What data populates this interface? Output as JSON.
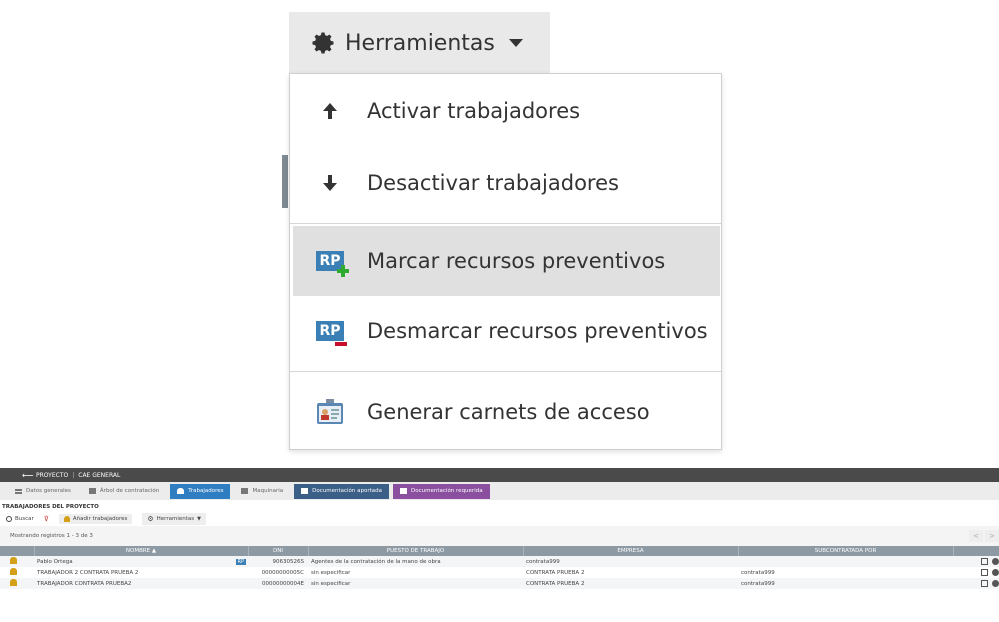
{
  "dropdown": {
    "button_label": "Herramientas",
    "items": [
      {
        "label": "Activar trabajadores",
        "icon": "arrow-up-icon"
      },
      {
        "label": "Desactivar trabajadores",
        "icon": "arrow-down-icon"
      },
      {
        "label": "Marcar recursos preventivos",
        "icon": "rp-add-icon",
        "badge": "RP",
        "highlighted": true
      },
      {
        "label": "Desmarcar recursos preventivos",
        "icon": "rp-remove-icon",
        "badge": "RP"
      },
      {
        "label": "Generar carnets de acceso",
        "icon": "id-card-icon"
      }
    ]
  },
  "app": {
    "breadcrumb": {
      "project": "PROYECTO",
      "name": "CAE GENERAL"
    },
    "tabs": [
      {
        "label": "Datos generales"
      },
      {
        "label": "Árbol de contratación"
      },
      {
        "label": "Trabajadores",
        "active": true
      },
      {
        "label": "Maquinaria"
      },
      {
        "label": "Documentación aportada"
      },
      {
        "label": "Documentación requerida"
      }
    ],
    "section_title": "TRABAJADORES DEL PROYECTO",
    "toolbar": {
      "search": "Buscar",
      "add_workers": "Añadir trabajadores",
      "tools": "Herramientas"
    },
    "showing": "Mostrando registros 1 - 3 de 3",
    "pager": {
      "prev": "<",
      "next": ">"
    },
    "table": {
      "columns": [
        "NOMBRE ▲",
        "DNI",
        "PUESTO DE TRABAJO",
        "EMPRESA",
        "SUBCONTRATADA POR"
      ],
      "rows": [
        {
          "nombre": "Pablo Ortega",
          "rp": "RP",
          "dni": "90630526S",
          "puesto": "Agentes de la contratación de la mano de obra",
          "empresa": "contrata999",
          "sub": ""
        },
        {
          "nombre": "TRABAJADOR 2 CONTRATA PRUEBA 2",
          "rp": "",
          "dni": "00000000005C",
          "puesto": "sin especificar",
          "empresa": "CONTRATA PRUEBA 2",
          "sub": "contrata999"
        },
        {
          "nombre": "TRABAJADOR CONTRATA PRUEBA2",
          "rp": "",
          "dni": "00000000004E",
          "puesto": "sin especificar",
          "empresa": "CONTRATA PRUEBA 2",
          "sub": "contrata999"
        }
      ]
    }
  },
  "colors": {
    "rp_blue": "#3a7fb5",
    "add_green": "#2eaa2e",
    "remove_red": "#c8102e",
    "active_tab": "#2f7ec1",
    "doc_tab_1": "#3b5f86",
    "doc_tab_2": "#8a4f9e",
    "header_gray": "#8d9aa3"
  }
}
